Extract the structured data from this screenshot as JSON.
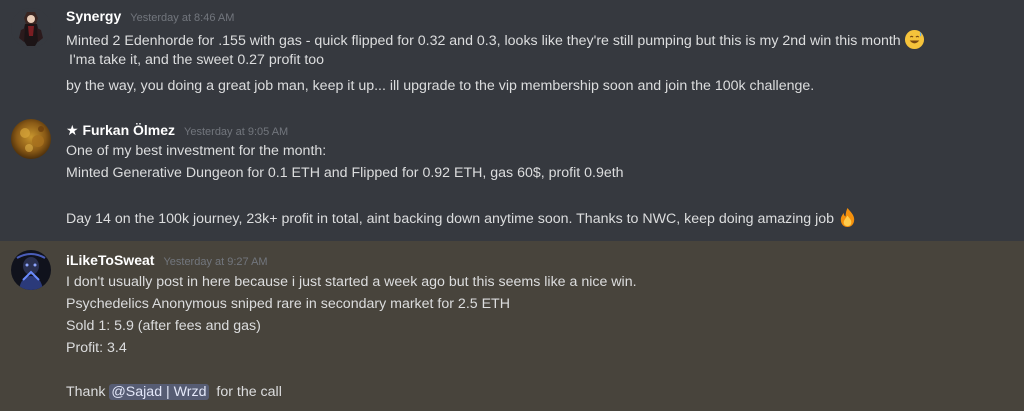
{
  "messages": [
    {
      "username": "Synergy",
      "timestamp": "Yesterday at 8:46 AM",
      "lines": [
        "Minted 2 Edenhorde for .155 with gas - quick flipped for 0.32 and 0.3, looks like they're still pumping but this is my 2nd win this month",
        "I'ma take it, and the sweet 0.27 profit too",
        "by the way, you doing a great job man, keep it up... ill upgrade to the vip membership soon and join the 100k challenge."
      ],
      "emoji": "sweat-smile-emoji"
    },
    {
      "username": "★ Furkan Ölmez",
      "timestamp": "Yesterday at 9:05 AM",
      "lines": [
        "One of my best investment for the month:",
        "Minted Generative Dungeon for 0.1 ETH and Flipped for 0.92 ETH, gas 60$, profit 0.9eth",
        "Day 14 on the 100k journey, 23k+ profit in total, aint backing down anytime soon. Thanks to NWC, keep doing amazing job"
      ],
      "emoji": "fire-emoji"
    },
    {
      "username": "iLikeToSweat",
      "timestamp": "Yesterday at 9:27 AM",
      "lines": [
        "I don't usually post in here because i just started a week ago but this seems like a nice win.",
        "Psychedelics Anonymous sniped rare in secondary market for 2.5 ETH",
        "Sold 1: 5.9 (after fees and gas)",
        "Profit: 3.4"
      ],
      "thank_prefix": "Thank",
      "mention": "@Sajad | Wrzd",
      "thank_suffix": "for the call"
    }
  ],
  "colors": {
    "background": "#36393f",
    "highlight_background": "#48443c",
    "username": "#ffffff",
    "timestamp": "#72767d",
    "text": "#dcddde",
    "mention_background": "#5865a0"
  }
}
